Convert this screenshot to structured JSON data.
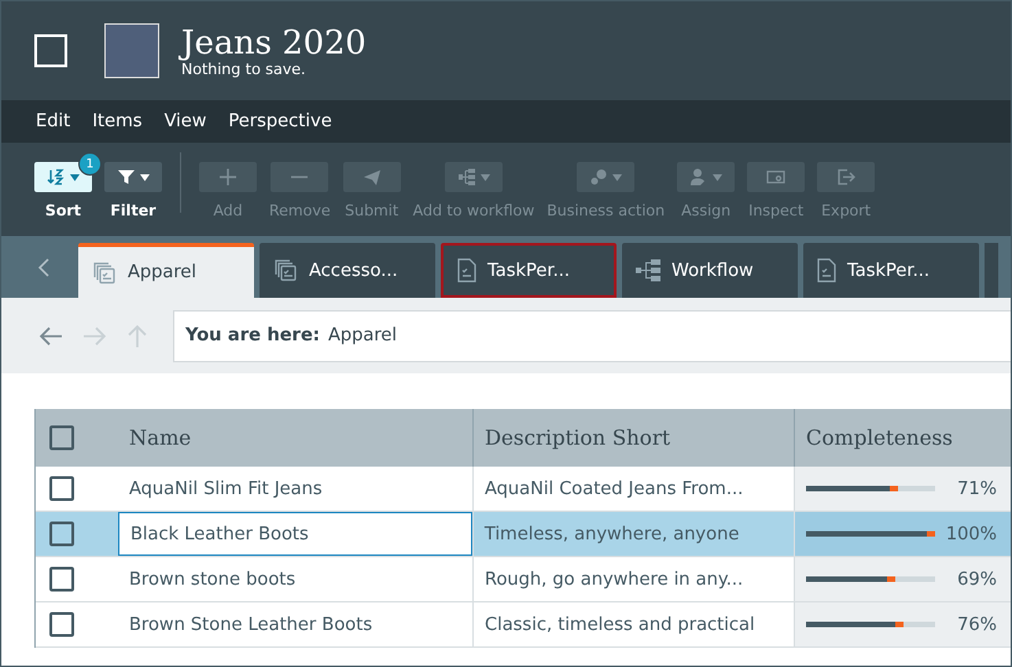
{
  "header": {
    "title": "Jeans 2020",
    "subtitle": "Nothing to save."
  },
  "menu": [
    "Edit",
    "Items",
    "View",
    "Perspective"
  ],
  "toolbar": [
    {
      "label": "Sort",
      "disabled": false,
      "active": true,
      "dropdown": true,
      "badge": "1"
    },
    {
      "label": "Filter",
      "disabled": false,
      "active": false,
      "dropdown": true
    },
    {
      "label": "Add",
      "disabled": true,
      "active": false,
      "dropdown": false
    },
    {
      "label": "Remove",
      "disabled": true,
      "active": false,
      "dropdown": false
    },
    {
      "label": "Submit",
      "disabled": true,
      "active": false,
      "dropdown": false
    },
    {
      "label": "Add to workflow",
      "disabled": true,
      "active": false,
      "dropdown": true
    },
    {
      "label": "Business action",
      "disabled": true,
      "active": false,
      "dropdown": true
    },
    {
      "label": "Assign",
      "disabled": true,
      "active": false,
      "dropdown": true
    },
    {
      "label": "Inspect",
      "disabled": true,
      "active": false,
      "dropdown": false
    },
    {
      "label": "Export",
      "disabled": true,
      "active": false,
      "dropdown": false
    }
  ],
  "tabs": [
    {
      "label": "Apparel",
      "kind": "collection",
      "selected": true,
      "highlighted": false
    },
    {
      "label": "Accesso...",
      "kind": "collection",
      "selected": false,
      "highlighted": false
    },
    {
      "label": "TaskPer...",
      "kind": "task",
      "selected": false,
      "highlighted": true
    },
    {
      "label": "Workflow",
      "kind": "workflow",
      "selected": false,
      "highlighted": false
    },
    {
      "label": "TaskPer...",
      "kind": "task",
      "selected": false,
      "highlighted": false
    }
  ],
  "breadcrumb": {
    "prefix": "You are here:",
    "location": "Apparel"
  },
  "table": {
    "all_checked": false,
    "columns": [
      "Name",
      "Description Short",
      "Completeness"
    ],
    "rows": [
      {
        "name": "AquaNil Slim Fit Jeans",
        "description": "AquaNil Coated Jeans From...",
        "level": 0.71,
        "reading": "71%",
        "selected": false,
        "checked": false
      },
      {
        "name": "Black Leather Boots",
        "description": "Timeless, anywhere, anyone",
        "level": 1.0,
        "reading": "100%",
        "selected": true,
        "checked": false
      },
      {
        "name": "Brown stone boots",
        "description": "Rough, go anywhere in any...",
        "level": 0.69,
        "reading": "69%",
        "selected": false,
        "checked": false
      },
      {
        "name": "Brown Stone Leather Boots",
        "description": "Classic, timeless and practical",
        "level": 0.76,
        "reading": "76%",
        "selected": false,
        "checked": false
      }
    ]
  }
}
